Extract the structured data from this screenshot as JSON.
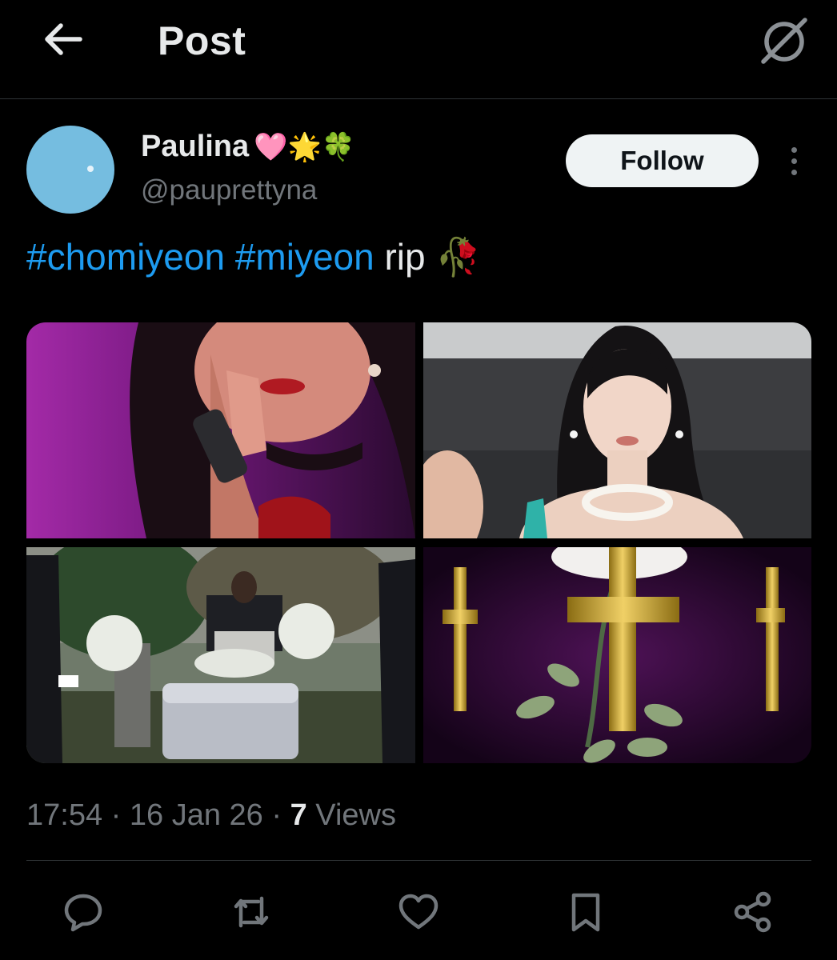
{
  "header": {
    "title": "Post",
    "back_icon": "arrow-left-icon",
    "grok_icon": "grok-icon"
  },
  "author": {
    "display_name": "Paulina",
    "badges": "🩷🌟🍀",
    "handle": "@pauprettyna",
    "avatar_color": "#75bde0"
  },
  "follow_label": "Follow",
  "more_icon": "more-vertical-icon",
  "post": {
    "hashtag_1": "#chomiyeon",
    "hashtag_2": "#miyeon",
    "text": "rip",
    "emoji": "🥀"
  },
  "media": {
    "count": 4,
    "images": [
      "singer-with-microphone",
      "woman-portrait",
      "funeral-casket",
      "golden-crosses-rose"
    ]
  },
  "meta": {
    "time": "17:54",
    "separator": " · ",
    "date": "16 Jan 26",
    "views_count": "7",
    "views_label": "Views"
  },
  "actions": {
    "reply_icon": "reply-icon",
    "repost_icon": "repost-icon",
    "like_icon": "heart-icon",
    "bookmark_icon": "bookmark-icon",
    "share_icon": "share-icon"
  },
  "colors": {
    "background": "#000000",
    "text": "#e7e9ea",
    "secondary": "#71767b",
    "link": "#1d9bf0",
    "divider": "#2f3336"
  }
}
